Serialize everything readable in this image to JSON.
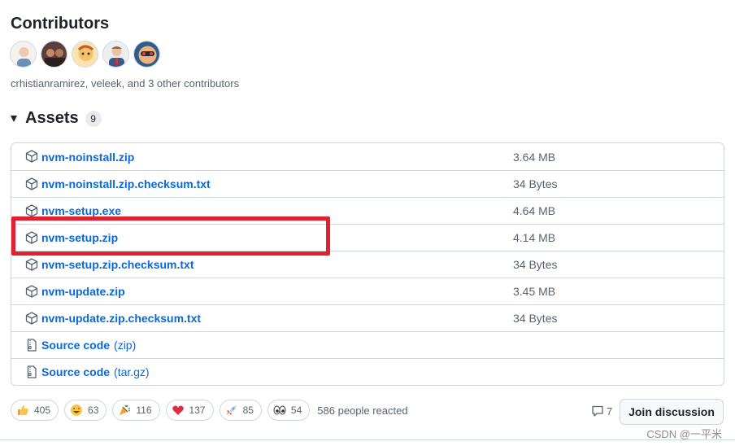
{
  "contributors": {
    "title": "Contributors",
    "summary": "crhistianramirez, veleek, and 3 other contributors",
    "avatars": [
      {
        "name": "avatar-1",
        "bg": "#f2d2c4",
        "fg": "#6b8fb5"
      },
      {
        "name": "avatar-2",
        "bg": "#3d2b2b",
        "fg": "#c98a6b"
      },
      {
        "name": "avatar-3",
        "bg": "#f3c26b",
        "fg": "#c65a2a"
      },
      {
        "name": "avatar-4",
        "bg": "#e8e8e8",
        "fg": "#3a5a8a"
      },
      {
        "name": "avatar-5",
        "bg": "#f1b37a",
        "fg": "#2e5d8c"
      }
    ]
  },
  "assets": {
    "title": "Assets",
    "count": "9",
    "items": [
      {
        "name": "nvm-noinstall.zip",
        "size": "3.64 MB",
        "icon": "package-icon"
      },
      {
        "name": "nvm-noinstall.zip.checksum.txt",
        "size": "34 Bytes",
        "icon": "package-icon"
      },
      {
        "name": "nvm-setup.exe",
        "size": "4.64 MB",
        "icon": "package-icon"
      },
      {
        "name": "nvm-setup.zip",
        "size": "4.14 MB",
        "icon": "package-icon"
      },
      {
        "name": "nvm-setup.zip.checksum.txt",
        "size": "34 Bytes",
        "icon": "package-icon"
      },
      {
        "name": "nvm-update.zip",
        "size": "3.45 MB",
        "icon": "package-icon"
      },
      {
        "name": "nvm-update.zip.checksum.txt",
        "size": "34 Bytes",
        "icon": "package-icon"
      },
      {
        "name": "Source code",
        "suffix": "(zip)",
        "size": "",
        "icon": "file-zip-icon"
      },
      {
        "name": "Source code",
        "suffix": "(tar.gz)",
        "size": "",
        "icon": "file-zip-icon"
      }
    ]
  },
  "reactions": {
    "items": [
      {
        "emoji": "thumbs-up-icon",
        "count": "405"
      },
      {
        "emoji": "laugh-icon",
        "count": "63"
      },
      {
        "emoji": "tada-icon",
        "count": "116"
      },
      {
        "emoji": "heart-icon",
        "count": "137"
      },
      {
        "emoji": "rocket-icon",
        "count": "85"
      },
      {
        "emoji": "eyes-icon",
        "count": "54"
      }
    ],
    "summary": "586 people reacted"
  },
  "comments": {
    "count": "7"
  },
  "join_button": "Join discussion",
  "watermark": "CSDN @一平米",
  "colors": {
    "link": "#0969da",
    "highlight": "#e02130",
    "border": "#d0d7de"
  }
}
